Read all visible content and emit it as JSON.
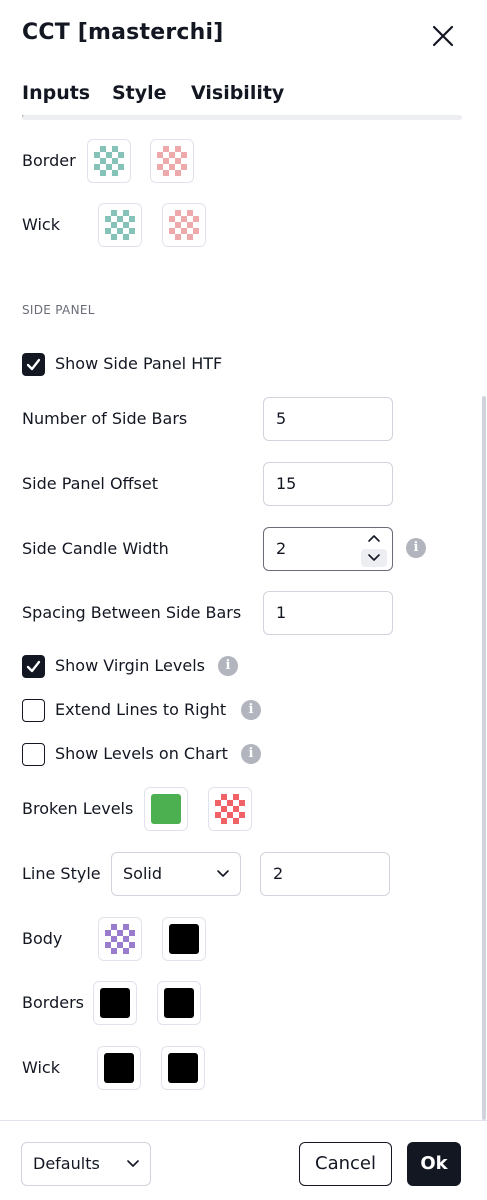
{
  "dialog": {
    "title": "CCT [masterchi]"
  },
  "tabs": [
    {
      "label": "Inputs",
      "active": true
    },
    {
      "label": "Style",
      "active": false
    },
    {
      "label": "Visibility",
      "active": false
    }
  ],
  "top_rows": {
    "border": {
      "label": "Border",
      "colors": [
        "#7fbfb5",
        "#eea6a6"
      ]
    },
    "wick": {
      "label": "Wick",
      "colors": [
        "#7fbfb5",
        "#eea6a6"
      ]
    }
  },
  "side_panel": {
    "section_title": "SIDE PANEL",
    "show_side_panel_htf": {
      "label": "Show Side Panel HTF",
      "checked": true
    },
    "number_of_side_bars": {
      "label": "Number of Side Bars",
      "value": "5"
    },
    "side_panel_offset": {
      "label": "Side Panel Offset",
      "value": "15"
    },
    "side_candle_width": {
      "label": "Side Candle Width",
      "value": "2"
    },
    "spacing_between_side_bars": {
      "label": "Spacing Between Side Bars",
      "value": "1"
    },
    "show_virgin_levels": {
      "label": "Show Virgin Levels",
      "checked": true
    },
    "extend_lines_to_right": {
      "label": "Extend Lines to Right",
      "checked": false
    },
    "show_levels_on_chart": {
      "label": "Show Levels on Chart",
      "checked": false
    },
    "broken_levels": {
      "label": "Broken Levels",
      "colors": [
        "#4caf50",
        "#f05a5e"
      ]
    },
    "line_style": {
      "label": "Line Style",
      "selected": "Solid",
      "width": "2"
    },
    "body": {
      "label": "Body",
      "colors": [
        "#9575cd",
        "#000000"
      ]
    },
    "borders": {
      "label": "Borders",
      "colors": [
        "#000000",
        "#000000"
      ]
    },
    "wick": {
      "label": "Wick",
      "colors": [
        "#000000",
        "#000000"
      ]
    }
  },
  "footer": {
    "defaults_label": "Defaults",
    "cancel_label": "Cancel",
    "ok_label": "Ok"
  },
  "icons": {
    "close": "close-icon",
    "check": "check-icon",
    "info": "info-icon",
    "chevron_down": "chevron-down-icon",
    "chevron_up": "chevron-up-icon"
  },
  "colors": {
    "text": "#131722",
    "muted": "#6a6d78",
    "border": "#d1d4dc",
    "info": "#b2b5be"
  }
}
